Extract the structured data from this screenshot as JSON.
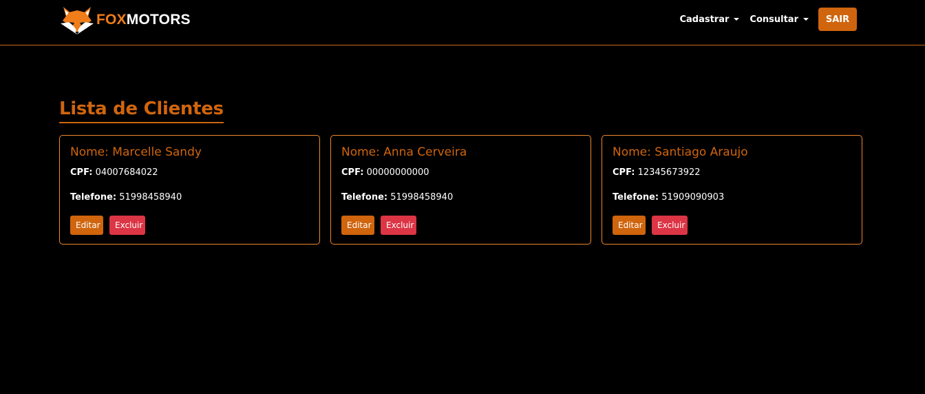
{
  "brand": {
    "fox": "FOX",
    "motors": "MOTORS",
    "logo_icon": "fox-head-icon"
  },
  "nav": {
    "register_label": "Cadastrar",
    "query_label": "Consultar",
    "logout_label": "SAIR"
  },
  "page": {
    "title": "Lista de Clientes"
  },
  "labels": {
    "name": "Nome: ",
    "cpf": "CPF:",
    "phone": "Telefone:",
    "edit": "Editar",
    "delete": "Excluir"
  },
  "clients": [
    {
      "name": "Marcelle Sandy",
      "cpf": "04007684022",
      "phone": "51998458940"
    },
    {
      "name": "Anna Cerveira",
      "cpf": "00000000000",
      "phone": "51998458940"
    },
    {
      "name": "Santiago Araujo",
      "cpf": "12345673922",
      "phone": "51909090903"
    }
  ],
  "colors": {
    "accent": "#d0650e",
    "border": "#ef8a2f",
    "danger": "#dc3545",
    "background": "#000000"
  }
}
